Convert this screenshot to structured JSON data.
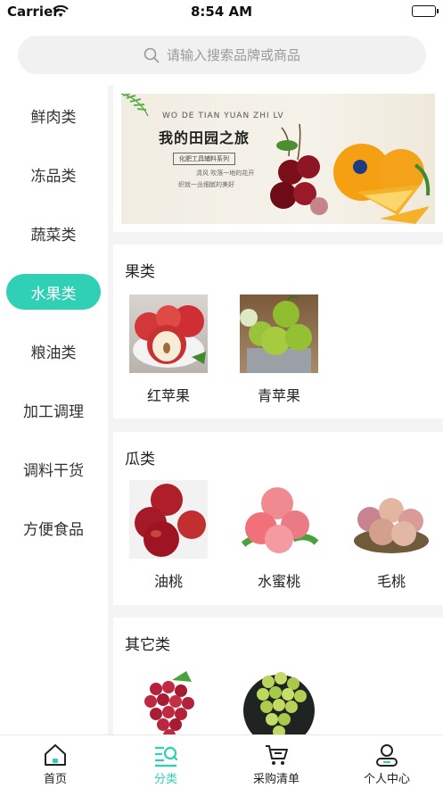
{
  "status_bar": {
    "carrier": "Carrier",
    "time": "8:54 AM"
  },
  "search": {
    "placeholder": "请输入搜索品牌或商品"
  },
  "sidebar": {
    "items": [
      {
        "label": "鲜肉类"
      },
      {
        "label": "冻品类"
      },
      {
        "label": "蔬菜类"
      },
      {
        "label": "水果类",
        "active": true
      },
      {
        "label": "粮油类"
      },
      {
        "label": "加工调理"
      },
      {
        "label": "调料干货"
      },
      {
        "label": "方便食品"
      }
    ]
  },
  "banner": {
    "subtitle": "WO DE TIAN YUAN ZHI LV",
    "title": "我的田园之旅",
    "tag": "化肥工具辅料系列",
    "line1": "清风 吹落一地的花开",
    "line2": "织就一丛细腻的美好"
  },
  "sections": [
    {
      "title": "果类",
      "products": [
        {
          "name": "红苹果"
        },
        {
          "name": "青苹果"
        }
      ]
    },
    {
      "title": "瓜类",
      "products": [
        {
          "name": "油桃"
        },
        {
          "name": "水蜜桃"
        },
        {
          "name": "毛桃"
        }
      ]
    },
    {
      "title": "其它类",
      "products": [
        {
          "name": ""
        },
        {
          "name": ""
        }
      ]
    }
  ],
  "tabs": [
    {
      "label": "首页",
      "icon": "home-icon"
    },
    {
      "label": "分类",
      "icon": "category-icon",
      "active": true
    },
    {
      "label": "采购清单",
      "icon": "cart-icon"
    },
    {
      "label": "个人中心",
      "icon": "user-icon"
    }
  ],
  "colors": {
    "accent": "#2fd0b5",
    "background": "#f4f4f4"
  }
}
